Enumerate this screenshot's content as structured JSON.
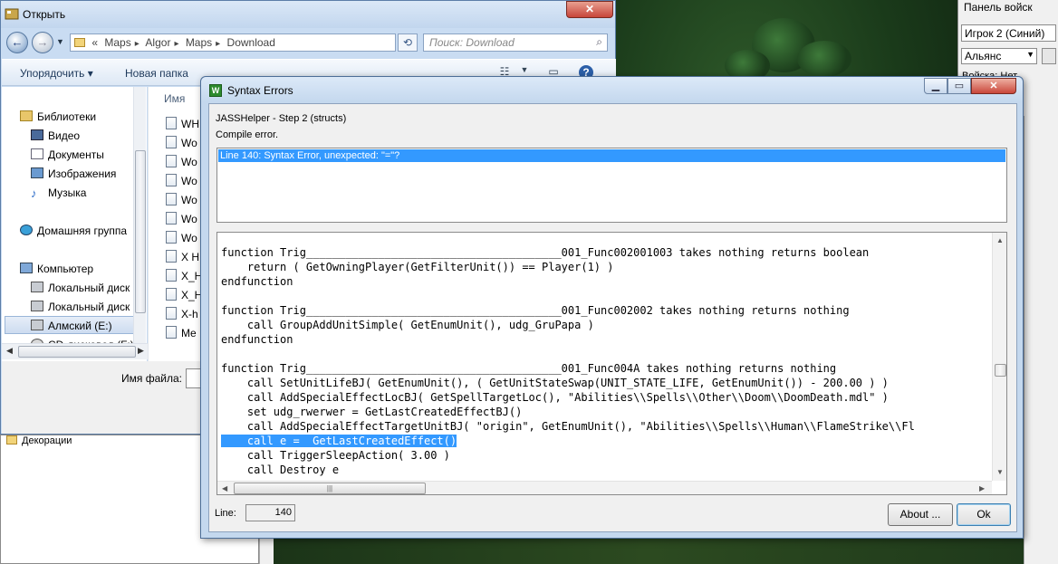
{
  "explorer": {
    "title": "Открыть",
    "breadcrumb": [
      "«",
      "Maps",
      "Algor",
      "Maps",
      "Download"
    ],
    "search_placeholder": "Поиск: Download",
    "toolbar": {
      "organize": "Упорядочить ▾",
      "new_folder": "Новая папка"
    },
    "column_header": "Имя",
    "nav_items": [
      {
        "label": "Библиотеки",
        "icon": "libraries-icon"
      },
      {
        "label": "Видео",
        "icon": "video-icon"
      },
      {
        "label": "Документы",
        "icon": "documents-icon"
      },
      {
        "label": "Изображения",
        "icon": "pictures-icon"
      },
      {
        "label": "Музыка",
        "icon": "music-icon"
      },
      {
        "label": "Домашняя группа",
        "icon": "homegroup-icon"
      },
      {
        "label": "Компьютер",
        "icon": "computer-icon"
      },
      {
        "label": "Локальный диск (C:)",
        "icon": "drive-icon"
      },
      {
        "label": "Локальный диск (D:)",
        "icon": "drive-icon"
      },
      {
        "label": "Алмский (E:)",
        "icon": "drive-icon"
      },
      {
        "label": "CD-дисковод (F:)",
        "icon": "cd-drive-icon"
      }
    ],
    "files": [
      "WH",
      "Wo",
      "Wo",
      "Wo",
      "Wo",
      "Wo",
      "Wo",
      "X H",
      "X_H",
      "X_H",
      "X-h",
      "Me"
    ],
    "file_name_label": "Имя файла:"
  },
  "deco_panel": {
    "item": "Декорации"
  },
  "voice_panel": {
    "title": "Панель войск",
    "player": "Игрок 2 (Синий)",
    "team": "Альянс",
    "troops": "Войска: Нет"
  },
  "dialog": {
    "title": "Syntax Errors",
    "step": "JASSHelper - Step 2 (structs)",
    "compile": "Compile error.",
    "errors": [
      "Line 140: Syntax Error, unexpected: \"=\"?"
    ],
    "code_lines": [
      "function Trig_______________________________________001_Func002001003 takes nothing returns boolean",
      "    return ( GetOwningPlayer(GetFilterUnit()) == Player(1) )",
      "endfunction",
      "",
      "function Trig_______________________________________001_Func002002 takes nothing returns nothing",
      "    call GroupAddUnitSimple( GetEnumUnit(), udg_GruPapa )",
      "endfunction",
      "",
      "function Trig_______________________________________001_Func004A takes nothing returns nothing",
      "    call SetUnitLifeBJ( GetEnumUnit(), ( GetUnitStateSwap(UNIT_STATE_LIFE, GetEnumUnit()) - 200.00 ) )",
      "    call AddSpecialEffectLocBJ( GetSpellTargetLoc(), \"Abilities\\\\Spells\\\\Other\\\\Doom\\\\DoomDeath.mdl\" )",
      "    set udg_rwerwer = GetLastCreatedEffectBJ()",
      "    call AddSpecialEffectTargetUnitBJ( \"origin\", GetEnumUnit(), \"Abilities\\\\Spells\\\\Human\\\\FlameStrike\\\\Fl",
      "    call e =  GetLastCreatedEffect()",
      "    call TriggerSleepAction( 3.00 )",
      "    call Destroy e"
    ],
    "highlight_line_index": 13,
    "line_label": "Line:",
    "line_value": "140",
    "about_label": "About ...",
    "ok_label": "Ok"
  }
}
